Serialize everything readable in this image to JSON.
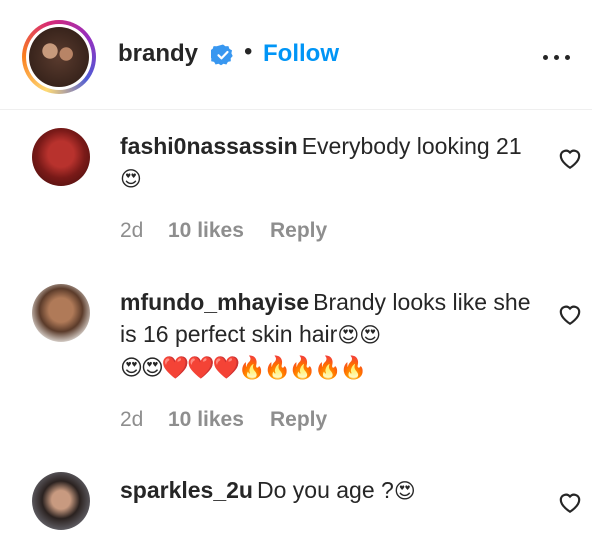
{
  "header": {
    "username": "brandy",
    "separator": "•",
    "follow_label": "Follow"
  },
  "comments": [
    {
      "username": "fashi0nassassin",
      "text": "Everybody looking 21",
      "emoji": "😍",
      "time": "2d",
      "likes": "10 likes",
      "reply": "Reply"
    },
    {
      "username": "mfundo_mhayise",
      "text": "Brandy looks like she is 16 perfect skin hair",
      "emoji": "😍😍",
      "emoji_line": "😍😍❤️❤️❤️🔥🔥🔥🔥🔥",
      "time": "2d",
      "likes": "10 likes",
      "reply": "Reply"
    },
    {
      "username": "sparkles_2u",
      "text": "Do you age ?",
      "emoji": "😍"
    }
  ],
  "colors": {
    "accent": "#0095f6",
    "text": "#262626",
    "muted": "#8e8e8e"
  }
}
